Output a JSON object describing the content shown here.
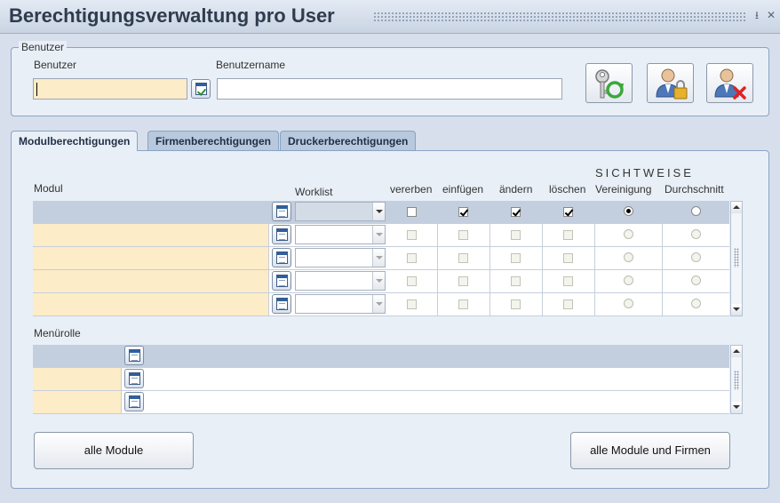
{
  "window": {
    "title": "Berechtigungsverwaltung pro User",
    "minimize_glyph": "⭳",
    "close_glyph": "✕"
  },
  "user_group": {
    "legend": "Benutzer",
    "user_label": "Benutzer",
    "user_value": "",
    "username_label": "Benutzername",
    "username_value": "",
    "action_icons": [
      "key-refresh-icon",
      "user-lock-icon",
      "user-delete-icon"
    ]
  },
  "tabs": [
    {
      "label": "Modulberechtigungen",
      "active": true
    },
    {
      "label": "Firmenberechtigungen",
      "active": false
    },
    {
      "label": "Druckerberechtigungen",
      "active": false
    }
  ],
  "module_grid": {
    "headers": {
      "modul": "Modul",
      "worklist": "Worklist",
      "vererben": "vererben",
      "einfuegen": "einfügen",
      "aendern": "ändern",
      "loeschen": "löschen",
      "sichtweise": "SICHTWEISE",
      "vereinigung": "Vereinigung",
      "durchschnitt": "Durchschnitt"
    },
    "rows": [
      {
        "modul": "",
        "worklist": "",
        "vererben": false,
        "einfuegen": true,
        "aendern": true,
        "loeschen": true,
        "sichtweise": "Vereinigung",
        "selected": true
      },
      {
        "modul": "",
        "worklist": "",
        "vererben": false,
        "einfuegen": false,
        "aendern": false,
        "loeschen": false,
        "sichtweise": "",
        "selected": false
      },
      {
        "modul": "",
        "worklist": "",
        "vererben": false,
        "einfuegen": false,
        "aendern": false,
        "loeschen": false,
        "sichtweise": "",
        "selected": false
      },
      {
        "modul": "",
        "worklist": "",
        "vererben": false,
        "einfuegen": false,
        "aendern": false,
        "loeschen": false,
        "sichtweise": "",
        "selected": false
      },
      {
        "modul": "",
        "worklist": "",
        "vererben": false,
        "einfuegen": false,
        "aendern": false,
        "loeschen": false,
        "sichtweise": "",
        "selected": false
      }
    ]
  },
  "menurolle_grid": {
    "label": "Menürolle",
    "rows": [
      {
        "value": "",
        "selected": true
      },
      {
        "value": "",
        "selected": false
      },
      {
        "value": "",
        "selected": false
      }
    ]
  },
  "buttons": {
    "alle_module": "alle Module",
    "alle_module_firmen": "alle Module und Firmen"
  },
  "colors": {
    "required_field": "#fcecc7",
    "selected_row": "#c3cfdf",
    "panel": "#e9eff7",
    "title_text": "#2f3c4e"
  }
}
